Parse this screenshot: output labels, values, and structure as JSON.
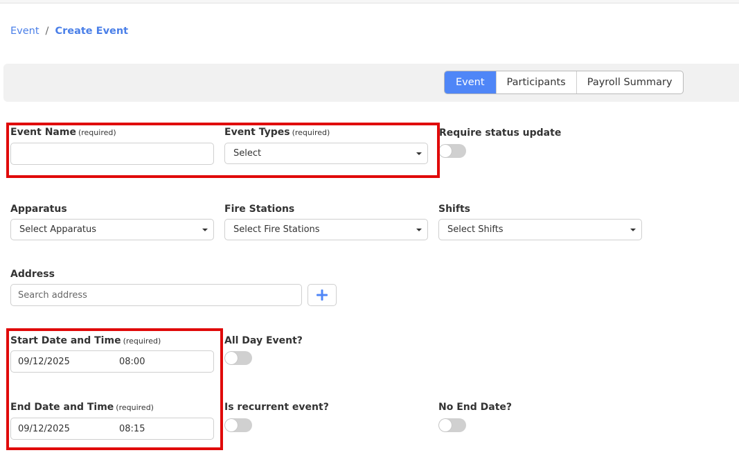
{
  "breadcrumb": {
    "parent": "Event",
    "separator": "/",
    "current": "Create Event"
  },
  "tabs": [
    {
      "label": "Event",
      "active": true
    },
    {
      "label": "Participants",
      "active": false
    },
    {
      "label": "Payroll Summary",
      "active": false
    }
  ],
  "form": {
    "required_tag": "(required)",
    "event_name": {
      "label": "Event Name",
      "value": ""
    },
    "event_types": {
      "label": "Event Types",
      "selected": "Select"
    },
    "require_status_update": {
      "label": "Require status update",
      "on": false
    },
    "apparatus": {
      "label": "Apparatus",
      "selected": "Select Apparatus"
    },
    "fire_stations": {
      "label": "Fire Stations",
      "selected": "Select Fire Stations"
    },
    "shifts": {
      "label": "Shifts",
      "selected": "Select Shifts"
    },
    "address": {
      "label": "Address",
      "placeholder": "Search address",
      "value": ""
    },
    "start": {
      "label": "Start Date and Time",
      "date": "09/12/2025",
      "time": "08:00"
    },
    "all_day": {
      "label": "All Day Event?",
      "on": false
    },
    "end": {
      "label": "End Date and Time",
      "date": "09/12/2025",
      "time": "08:15"
    },
    "recurrent": {
      "label": "Is recurrent event?",
      "on": false
    },
    "no_end_date": {
      "label": "No End Date?",
      "on": false
    }
  },
  "colors": {
    "accent": "#4f86f7",
    "link": "#4a7fe8",
    "highlight": "#e00a0a",
    "toggle_off": "#d0d0d0"
  },
  "icons": {
    "add": "plus-icon",
    "dropdown": "caret-down-icon"
  }
}
